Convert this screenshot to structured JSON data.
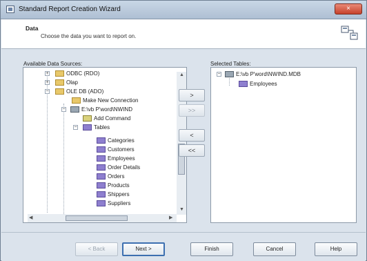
{
  "window": {
    "title": "Standard Report Creation Wizard",
    "close_glyph": "×"
  },
  "header": {
    "title": "Data",
    "subtitle": "Choose the data you want to report on."
  },
  "left_panel": {
    "label": "Available Data Sources:",
    "tree": [
      {
        "label": "ODBC (RDO)",
        "icon": "folder-icon",
        "toggle": "+"
      },
      {
        "label": "Olap",
        "icon": "folder-icon",
        "toggle": "+"
      },
      {
        "label": "OLE DB (ADO)",
        "icon": "folder-icon",
        "toggle": "−"
      },
      {
        "label": "Make New Connection",
        "icon": "folder-icon"
      },
      {
        "label": "E:\\vb P'word\\NWIND",
        "icon": "database-icon",
        "toggle": "−"
      },
      {
        "label": "Add Command",
        "icon": "command-icon"
      },
      {
        "label": "Tables",
        "icon": "table-icon",
        "toggle": "−"
      },
      {
        "label": "Categories",
        "icon": "table-icon"
      },
      {
        "label": "Customers",
        "icon": "table-icon"
      },
      {
        "label": "Employees",
        "icon": "table-icon"
      },
      {
        "label": "Order Details",
        "icon": "table-icon"
      },
      {
        "label": "Orders",
        "icon": "table-icon"
      },
      {
        "label": "Products",
        "icon": "table-icon"
      },
      {
        "label": "Shippers",
        "icon": "table-icon"
      },
      {
        "label": "Suppliers",
        "icon": "table-icon"
      }
    ]
  },
  "right_panel": {
    "label": "Selected Tables:",
    "tree": [
      {
        "label": "E:\\vb P'word\\NWIND.MDB",
        "icon": "database-icon",
        "toggle": "−"
      },
      {
        "label": "Employees",
        "icon": "table-icon"
      }
    ]
  },
  "transfer_buttons": {
    "add": ">",
    "add_all": ">>",
    "remove": "<",
    "remove_all": "<<"
  },
  "footer": {
    "back": "< Back",
    "next": "Next >",
    "finish": "Finish",
    "cancel": "Cancel",
    "help": "Help"
  }
}
